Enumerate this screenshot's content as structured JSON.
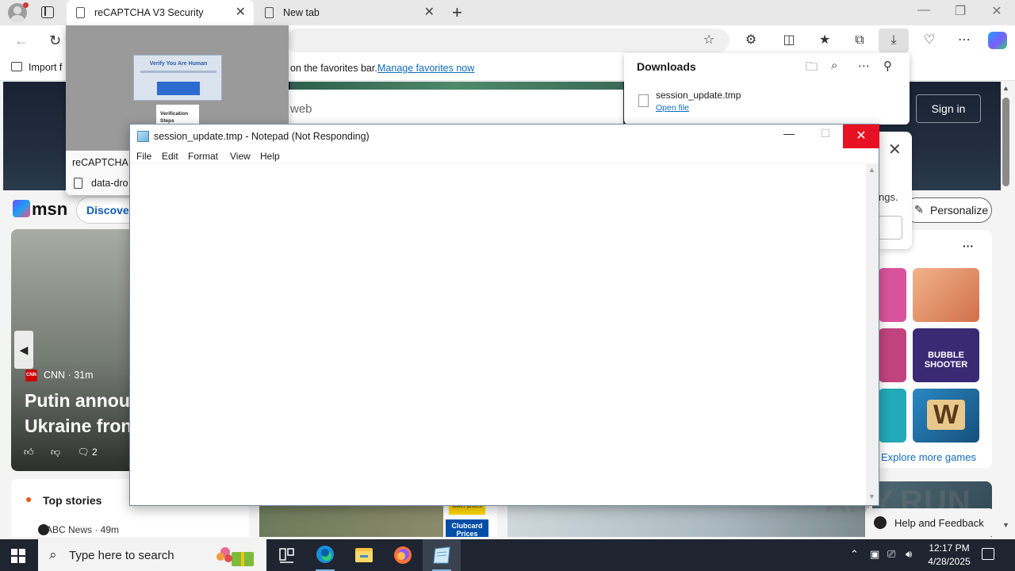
{
  "browser": {
    "tabs": [
      {
        "title": "reCAPTCHA V3 Security",
        "active": true
      },
      {
        "title": "New tab",
        "active": false
      }
    ],
    "favorites_bar": {
      "import_label": "Import f",
      "message": "on the favorites bar.",
      "manage_link": "Manage favorites now"
    },
    "accent": "#0f6cbd"
  },
  "tab_preview": {
    "title": "reCAPTCHA V",
    "url": "data-dro",
    "card_title": "Verify You Are Human",
    "steps_text": "Verification Steps"
  },
  "downloads": {
    "title": "Downloads",
    "file_name": "session_update.tmp",
    "open_label": "Open file"
  },
  "msn": {
    "search_placeholder": "web",
    "sign_in": "Sign in",
    "logo": "msn",
    "discover": "Discover",
    "personalize": "Personalize",
    "side_popup_text": "ngs.",
    "news": {
      "source": "CNN · 31m",
      "source_badge": "CNN",
      "headline_1": "Putin annou",
      "headline_2": "Ukraine fron",
      "comments": "2"
    },
    "top_stories": {
      "title": "Top stories",
      "source": "ABC News · 49m"
    },
    "ad": {
      "clubcard": "Clubcard Prices",
      "lower_prices": "lower prices"
    },
    "games": {
      "more": "···",
      "explore": "Explore more games",
      "tiles": [
        {
          "name": "pink-game",
          "color": "#d9539c"
        },
        {
          "name": "doctor-game",
          "color": "#e5895a"
        },
        {
          "name": "puck-game",
          "color": "#c2447f"
        },
        {
          "name": "bubble-shooter",
          "color": "#3a2a74",
          "label": "BUBBLE SHOOTER"
        },
        {
          "name": "green-game",
          "color": "#23a9b7"
        },
        {
          "name": "word-game",
          "color": "#1d6fa4",
          "label": "W"
        }
      ]
    },
    "help_feedback": "Help and Feedback",
    "watermark": "ANY.RUN"
  },
  "notepad": {
    "title": "session_update.tmp - Notepad (Not Responding)",
    "menu": [
      "File",
      "Edit",
      "Format",
      "View",
      "Help"
    ],
    "content": ""
  },
  "taskbar": {
    "search_placeholder": "Type here to search",
    "time": "12:17 PM",
    "date": "4/28/2025"
  }
}
